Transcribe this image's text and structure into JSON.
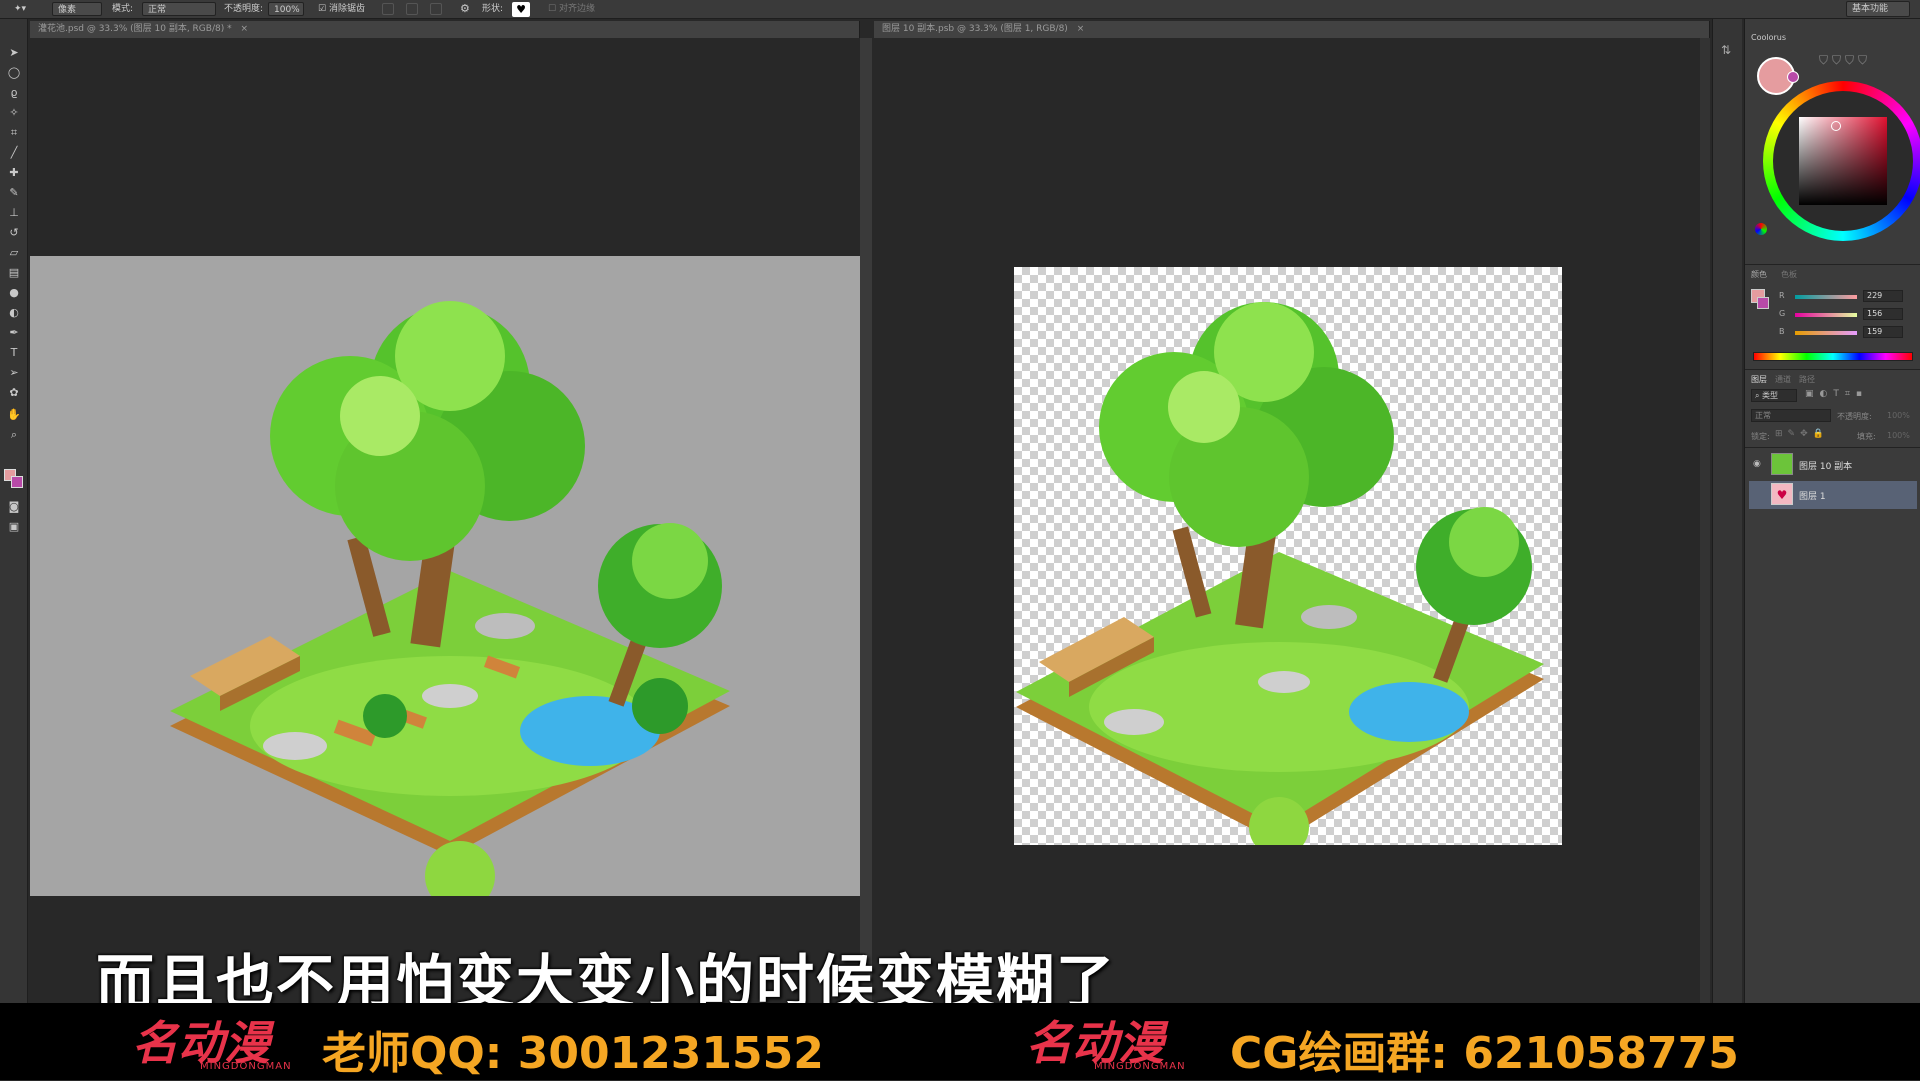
{
  "options_bar": {
    "pixel_mode": "像素",
    "mode_label": "模式:",
    "mode_value": "正常",
    "opacity_label": "不透明度:",
    "opacity_value": "100%",
    "antialias_label": "消除锯齿",
    "shape_label": "形状:",
    "align_label": "对齐边缘",
    "workspace": "基本功能"
  },
  "documents": [
    {
      "tab": "灌花池.psd @ 33.3% (图层 10 副本, RGB/8) *",
      "close": "×"
    },
    {
      "tab": "图层 10 副本.psb @ 33.3% (图层 1, RGB/8)",
      "close": "×"
    }
  ],
  "coolorus": {
    "title": "Coolorus",
    "foreground_color": "#e59c9f"
  },
  "color_panel": {
    "tabs": [
      "颜色",
      "色板"
    ],
    "channels": [
      {
        "label": "R",
        "value": "229"
      },
      {
        "label": "G",
        "value": "156"
      },
      {
        "label": "B",
        "value": "159"
      }
    ]
  },
  "layers_panel": {
    "tabs": [
      "图层",
      "通道",
      "路径"
    ],
    "filter_label": "类型",
    "blend_mode": "正常",
    "opacity_label": "不透明度:",
    "opacity_value": "100%",
    "lock_label": "锁定:",
    "fill_label": "填充:",
    "fill_value": "100%",
    "layers": [
      {
        "name": "图层 10 副本",
        "visible": true,
        "selected": false
      },
      {
        "name": "图层 1",
        "visible": false,
        "selected": true
      }
    ]
  },
  "subtitle": "而且也不用怕变大变小的时候变模糊了",
  "footer": {
    "logo_text": "名动漫",
    "logo_sub": "MINGDONGMAN",
    "teacher_qq": "老师QQ: 3001231552",
    "group": "CG绘画群: 621058775"
  },
  "colors": {
    "accent_orange": "#f5a623",
    "logo_red": "#e8334a",
    "canvas_gray": "#a5a5a5"
  }
}
